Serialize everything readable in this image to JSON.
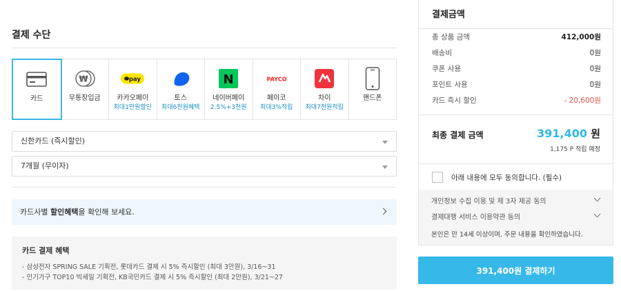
{
  "payment_method": {
    "title": "결제 수단",
    "methods": [
      {
        "label": "카드",
        "sub": "",
        "icon": "credit-card-icon"
      },
      {
        "label": "무통장입금",
        "sub": "",
        "icon": "coin-won-icon"
      },
      {
        "label": "카카오페이",
        "sub": "최대1만원할인",
        "icon": "kakaopay-icon",
        "badge": "pay"
      },
      {
        "label": "토스",
        "sub": "최대6천원혜택",
        "icon": "toss-icon"
      },
      {
        "label": "네이버페이",
        "sub": "2.5%+3천원",
        "icon": "naver-icon",
        "badge": "N"
      },
      {
        "label": "페이코",
        "sub": "최대3%적립",
        "icon": "payco-icon",
        "badge": "PAYCO"
      },
      {
        "label": "차이",
        "sub": "최대7천원적립",
        "icon": "chai-icon"
      },
      {
        "label": "핸드폰",
        "sub": "",
        "icon": "smartphone-icon"
      }
    ],
    "card_select": "신한카드 (즉시할인)",
    "installment_select": "7개월 (무이자)",
    "benefit_link": {
      "prefix": "카드사별 ",
      "bold": "할인혜택",
      "suffix": "을 확인해 보세요."
    },
    "benefits": {
      "title": "카드 결제 혜택",
      "lines": [
        "- 삼성전자 SPRING SALE 기획전, 롯데카드 결제 시 5% 즉시할인 (최대 3만원), 3/16~31",
        "- 인기가구 TOP10 빅세일 기획전, KB국민카드 결제 시 5% 즉시할인 (최대 2만원), 3/21~27"
      ]
    }
  },
  "summary": {
    "title": "결제금액",
    "rows": [
      {
        "label": "총 상품 금액",
        "value": "412,000원"
      },
      {
        "label": "배송비",
        "value": "0원"
      },
      {
        "label": "쿠폰 사용",
        "value": "0원"
      },
      {
        "label": "포인트 사용",
        "value": "0원"
      },
      {
        "label": "카드 즉시 할인",
        "value": "- 20,600원"
      }
    ],
    "final_label": "최종 결제 금액",
    "final_amount": "391,400",
    "final_unit": " 원",
    "points_note": "1,175 P 적립 예정",
    "agree_label": "아래 내용에 모두 동의합니다. (필수)",
    "terms": [
      "개인정보 수집 이용 및 제 3자 제공 동의",
      "결제대행 서비스 이용약관 동의"
    ],
    "terms_note": "본인은 만 14세 이상이며, 주문 내용을 확인하였습니다."
  },
  "pay_button": "391,400원 결제하기",
  "colors": {
    "accent": "#36b8e8",
    "discount_red": "#e5534b",
    "kakao_yellow": "#fee500",
    "toss_blue": "#1264f0",
    "naver_green": "#03c75a",
    "payco_red": "#fa2828",
    "chai_red": "#f0323c"
  }
}
